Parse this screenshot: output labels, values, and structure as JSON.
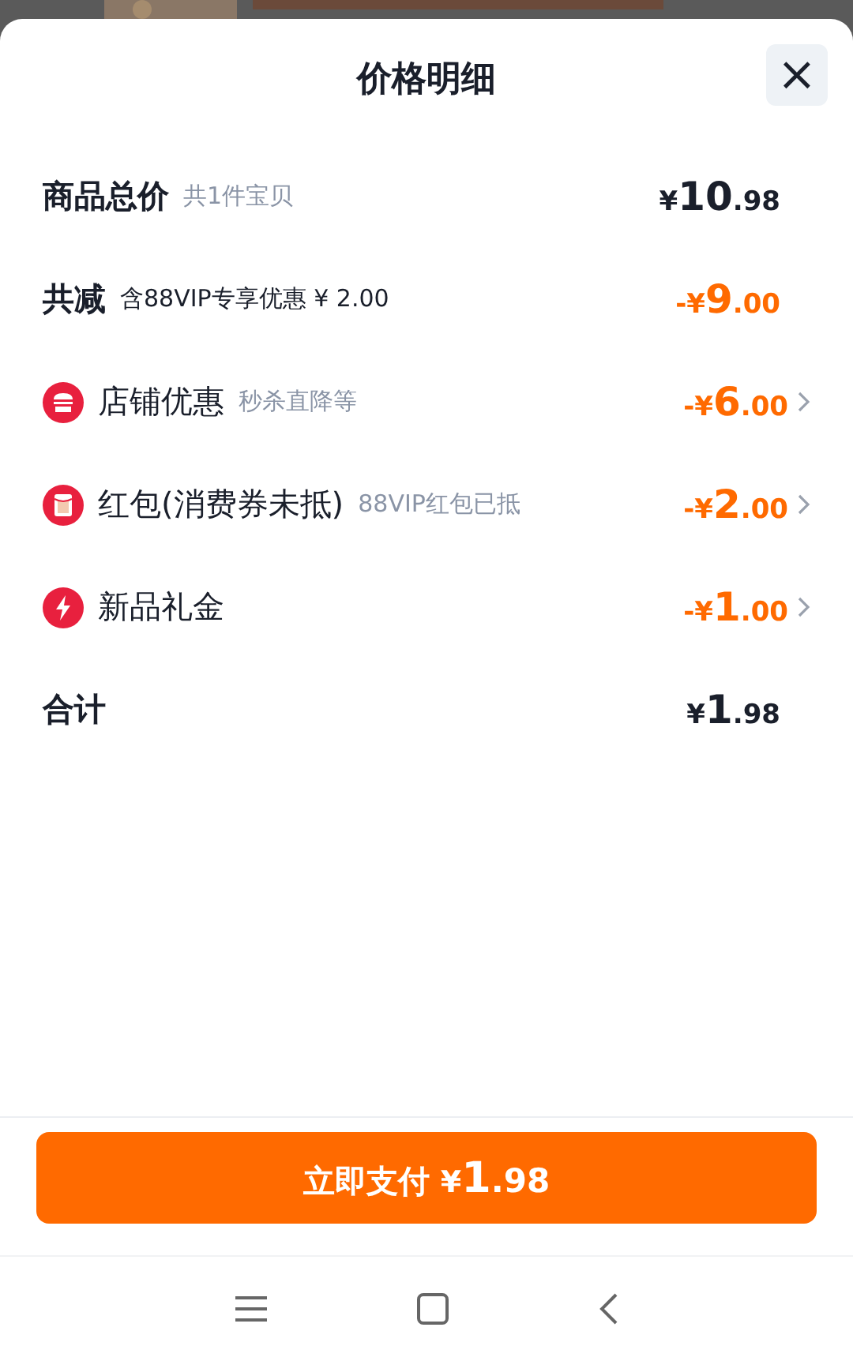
{
  "sheet": {
    "title": "价格明细",
    "close_icon": "×"
  },
  "rows": [
    {
      "kind": "summary",
      "label": "商品总价",
      "note": "共1件宝贝",
      "amount": {
        "sign": "¥",
        "integer": "10",
        "decimals": ".98"
      }
    },
    {
      "kind": "reduction",
      "label": "共减",
      "note": "含88VIP专享优惠 ¥ 2.00",
      "amount": {
        "sign": "-¥",
        "integer": "9",
        "decimals": ".00"
      }
    },
    {
      "kind": "discount",
      "label": "店铺优惠",
      "note": "秒杀直降等",
      "amount": {
        "sign": "-¥",
        "integer": "6",
        "decimals": ".00"
      }
    },
    {
      "kind": "discount",
      "label": "红包(消费券未抵)",
      "note": "88VIP红包已抵",
      "amount": {
        "sign": "-¥",
        "integer": "2",
        "decimals": ".00"
      }
    },
    {
      "kind": "discount",
      "label": "新品礼金",
      "amount": {
        "sign": "-¥",
        "integer": "1",
        "decimals": ".00"
      }
    },
    {
      "kind": "summary",
      "label": "合计",
      "amount": {
        "sign": "¥",
        "integer": "1",
        "decimals": ".98"
      }
    }
  ],
  "pay_button": {
    "label": "立即支付",
    "amount": {
      "sign": "¥",
      "integer": "1",
      "decimals": ".98"
    }
  }
}
